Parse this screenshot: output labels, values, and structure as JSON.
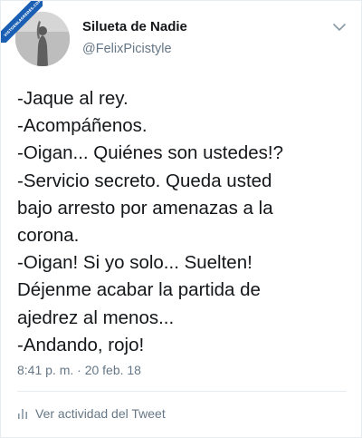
{
  "user": {
    "display_name": "Silueta de Nadie",
    "handle": "@FelixPicistyle",
    "avatar_icon": "silhouette-photo"
  },
  "watermark": {
    "text": "VISTOENLASREDES.COM"
  },
  "tweet": {
    "lines": [
      "-Jaque al rey.",
      "-Acompáñenos.",
      "-Oigan... Quiénes son ustedes!?",
      "-Servicio secreto. Queda usted",
      "bajo arresto por amenazas a la",
      "corona.",
      "-Oigan! Si yo solo... Suelten!",
      "Déjenme acabar la partida de",
      "ajedrez al menos...",
      "-Andando, rojo!"
    ],
    "timestamp": "8:41 p. m. · 20 feb. 18"
  },
  "actions": {
    "activity_label": "Ver actividad del Tweet",
    "activity_icon": "bar-chart-icon",
    "menu_icon": "chevron-down-icon"
  },
  "colors": {
    "text": "#14171a",
    "secondary": "#657786",
    "divider": "#e6ecf0",
    "watermark": "#1a5fb4"
  }
}
